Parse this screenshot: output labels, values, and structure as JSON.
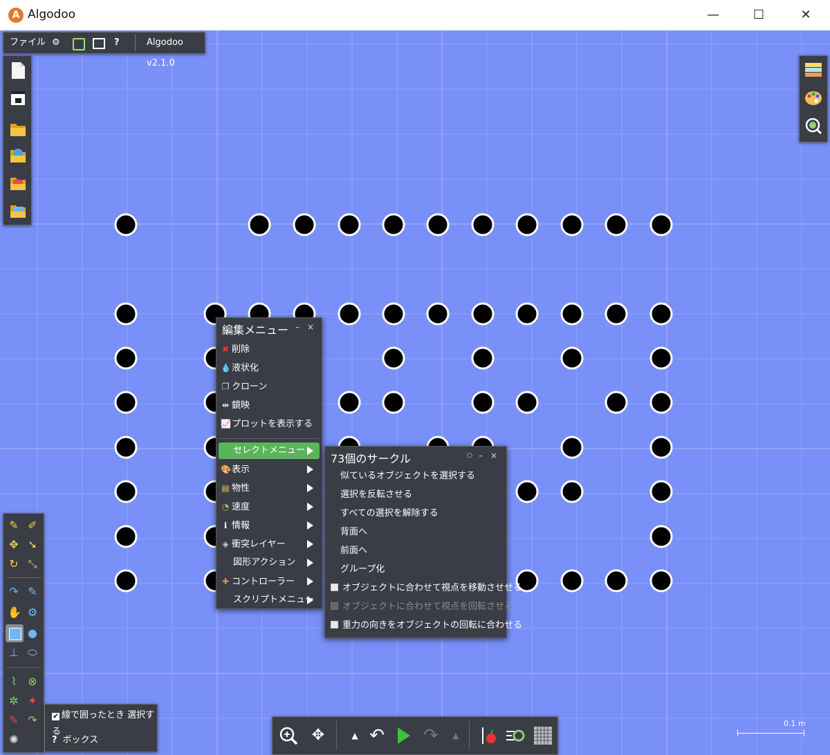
{
  "window": {
    "title": "Algodoo",
    "minimize": "—",
    "maximize": "☐",
    "close": "✕"
  },
  "top_toolbar": {
    "file_label": "ファイル",
    "help_label": "?",
    "version": "Algodoo v2.1.0"
  },
  "edit_menu": {
    "title": "編集メニュー",
    "minimize": "–",
    "close": "×",
    "items": [
      {
        "label": "削除",
        "icon": "delete-icon"
      },
      {
        "label": "液状化",
        "icon": "liquify-icon"
      },
      {
        "label": "クローン",
        "icon": "clone-icon"
      },
      {
        "label": "鏡映",
        "icon": "mirror-icon"
      },
      {
        "label": "プロットを表示する",
        "icon": "plot-icon"
      }
    ],
    "submenus": [
      {
        "label": "セレクトメニュー",
        "icon": "",
        "highlighted": true
      },
      {
        "label": "表示",
        "icon": "palette-icon"
      },
      {
        "label": "物性",
        "icon": "material-icon"
      },
      {
        "label": "速度",
        "icon": "speed-icon"
      },
      {
        "label": "情報",
        "icon": "info-icon"
      },
      {
        "label": "衝突レイヤー",
        "icon": "layers-icon"
      },
      {
        "label": "図形アクション",
        "icon": ""
      },
      {
        "label": "コントローラー",
        "icon": "controller-icon"
      },
      {
        "label": "スクリプトメニュー",
        "icon": ""
      }
    ]
  },
  "select_menu": {
    "title": "73個のサークル",
    "pin": "○",
    "minimize": "–",
    "close": "×",
    "items": [
      {
        "label": "似ているオブジェクトを選択する"
      },
      {
        "label": "選択を反転させる"
      },
      {
        "label": "すべての選択を解除する"
      },
      {
        "label": "背面へ"
      },
      {
        "label": "前面へ"
      },
      {
        "label": "グループ化"
      }
    ],
    "checkboxes": [
      {
        "label": "オブジェクトに合わせて視点を移動させせる",
        "checked": false,
        "disabled": false
      },
      {
        "label": "オブジェクトに合わせて視点を回転させる",
        "checked": false,
        "disabled": true
      },
      {
        "label": "重力の向きをオブジェクトの回転に合わせる",
        "checked": false,
        "disabled": false
      }
    ]
  },
  "options_panel": {
    "lasso_label": "線で囲ったとき 選択する",
    "lasso_checked": true,
    "help_glyph": "?",
    "tool_name": "ボックス"
  },
  "scale": {
    "label": "0.1 m"
  },
  "colors": {
    "canvas": "#7890f8",
    "panel": "#3a3d45",
    "highlight": "#5ab55a",
    "play": "#3cc43c"
  }
}
